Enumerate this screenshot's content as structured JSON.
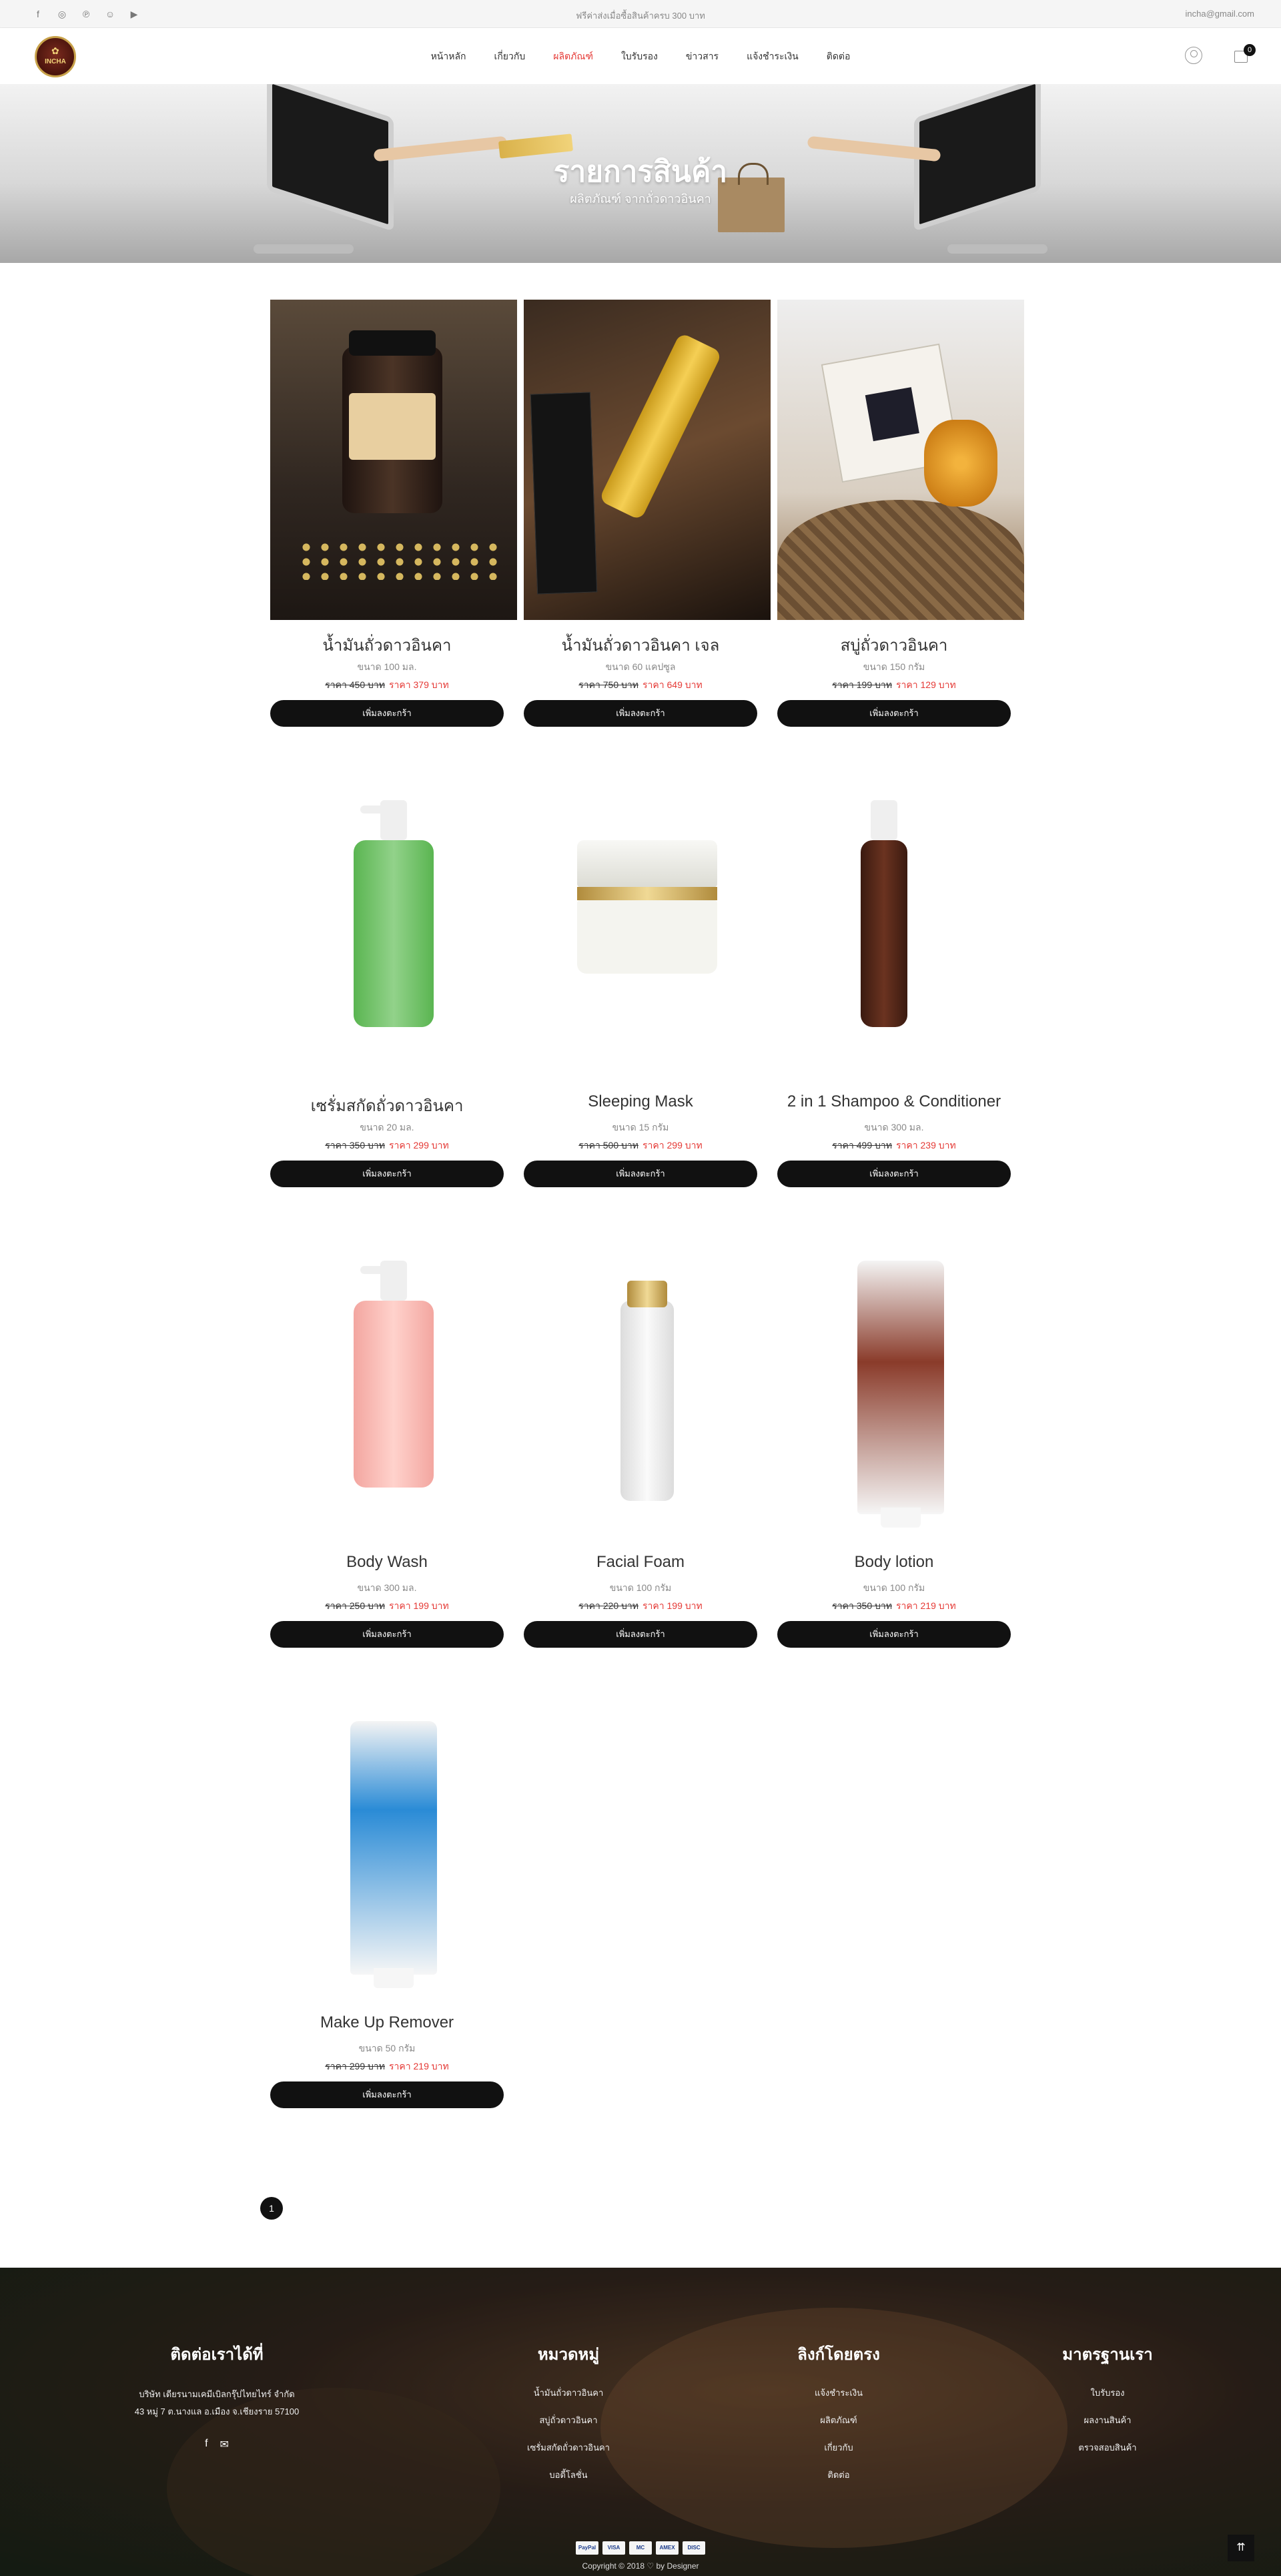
{
  "topbar": {
    "promo": "ฟรีค่าส่งเมื่อซื้อสินค้าครบ 300 บาท",
    "email": "incha@gmail.com",
    "social_icons": [
      "facebook-icon",
      "instagram-icon",
      "pinterest-icon",
      "snapchat-icon",
      "youtube-icon"
    ]
  },
  "header": {
    "logo_text": "INCHA",
    "nav": [
      {
        "label": "หน้าหลัก",
        "active": false
      },
      {
        "label": "เกี่ยวกับ",
        "active": false
      },
      {
        "label": "ผลิตภัณฑ์",
        "active": true
      },
      {
        "label": "ใบรับรอง",
        "active": false
      },
      {
        "label": "ข่าวสาร",
        "active": false
      },
      {
        "label": "แจ้งชำระเงิน",
        "active": false
      },
      {
        "label": "ติดต่อ",
        "active": false
      }
    ],
    "cart_count": "0"
  },
  "banner": {
    "title": "รายการสินค้า",
    "subtitle": "ผลิตภัณฑ์ จากถั่วดาวอินคา"
  },
  "products": [
    {
      "name": "น้ำมันถั่วดาวอินคา",
      "size": "ขนาด 100 มล.",
      "old_price": "ราคา 450 บาท",
      "new_price": "ราคา 379 บาท",
      "button": "เพิ่มลงตะกร้า"
    },
    {
      "name": "น้ำมันถั่วดาวอินคา เจล",
      "size": "ขนาด 60 แคปซูล",
      "old_price": "ราคา 750 บาท",
      "new_price": "ราคา 649 บาท",
      "button": "เพิ่มลงตะกร้า"
    },
    {
      "name": "สบู่ถั่วดาวอินคา",
      "size": "ขนาด 150 กรัม",
      "old_price": "ราคา 199 บาท",
      "new_price": "ราคา 129 บาท",
      "button": "เพิ่มลงตะกร้า"
    },
    {
      "name": "เซรั่มสกัดถั่วดาวอินคา",
      "size": "ขนาด 20 มล.",
      "old_price": "ราคา 350 บาท",
      "new_price": "ราคา 299 บาท",
      "button": "เพิ่มลงตะกร้า"
    },
    {
      "name": "Sleeping Mask",
      "size": "ขนาด 15 กรัม",
      "old_price": "ราคา 500 บาท",
      "new_price": "ราคา 299 บาท",
      "button": "เพิ่มลงตะกร้า"
    },
    {
      "name": "2 in 1 Shampoo & Conditioner",
      "size": "ขนาด 300 มล.",
      "old_price": "ราคา 499 บาท",
      "new_price": "ราคา 239 บาท",
      "button": "เพิ่มลงตะกร้า"
    },
    {
      "name": "Body Wash",
      "size": "ขนาด 300 มล.",
      "old_price": "ราคา 250 บาท",
      "new_price": "ราคา 199 บาท",
      "button": "เพิ่มลงตะกร้า"
    },
    {
      "name": "Facial Foam",
      "size": "ขนาด 100 กรัม",
      "old_price": "ราคา 220 บาท",
      "new_price": "ราคา 199 บาท",
      "button": "เพิ่มลงตะกร้า"
    },
    {
      "name": "Body lotion",
      "size": "ขนาด 100 กรัม",
      "old_price": "ราคา 350 บาท",
      "new_price": "ราคา 219 บาท",
      "button": "เพิ่มลงตะกร้า"
    },
    {
      "name": "Make Up Remover",
      "size": "ขนาด 50 กรัม",
      "old_price": "ราคา 299 บาท",
      "new_price": "ราคา 219 บาท",
      "button": "เพิ่มลงตะกร้า"
    }
  ],
  "pagination": {
    "current": "1"
  },
  "footer": {
    "contact": {
      "title": "ติดต่อเราได้ที่",
      "address_line1": "บริษัท เดียรนามเคมีเบิลกรุ๊ปไทยไทร์ จำกัด",
      "address_line2": "43 หมู่ 7 ต.นางแล อ.เมือง จ.เชียงราย 57100"
    },
    "categories": {
      "title": "หมวดหมู่",
      "items": [
        "น้ำมันถั่วดาวอินคา",
        "สบู่ถั่วดาวอินคา",
        "เซรั่มสกัดถั่วดาวอินคา",
        "บอดี้โลชั่น"
      ]
    },
    "links": {
      "title": "ลิงก์โดยตรง",
      "items": [
        "แจ้งชำระเงิน",
        "ผลิตภัณฑ์",
        "เกี่ยวกับ",
        "ติดต่อ"
      ]
    },
    "standards": {
      "title": "มาตรฐานเรา",
      "items": [
        "ใบรับรอง",
        "ผลงานสินค้า",
        "ตรวจสอบสินค้า"
      ]
    },
    "payments": [
      "PayPal",
      "VISA",
      "MC",
      "AMEX",
      "DISC"
    ],
    "copyright": "Copyright © 2018 ♡ by Designer"
  }
}
